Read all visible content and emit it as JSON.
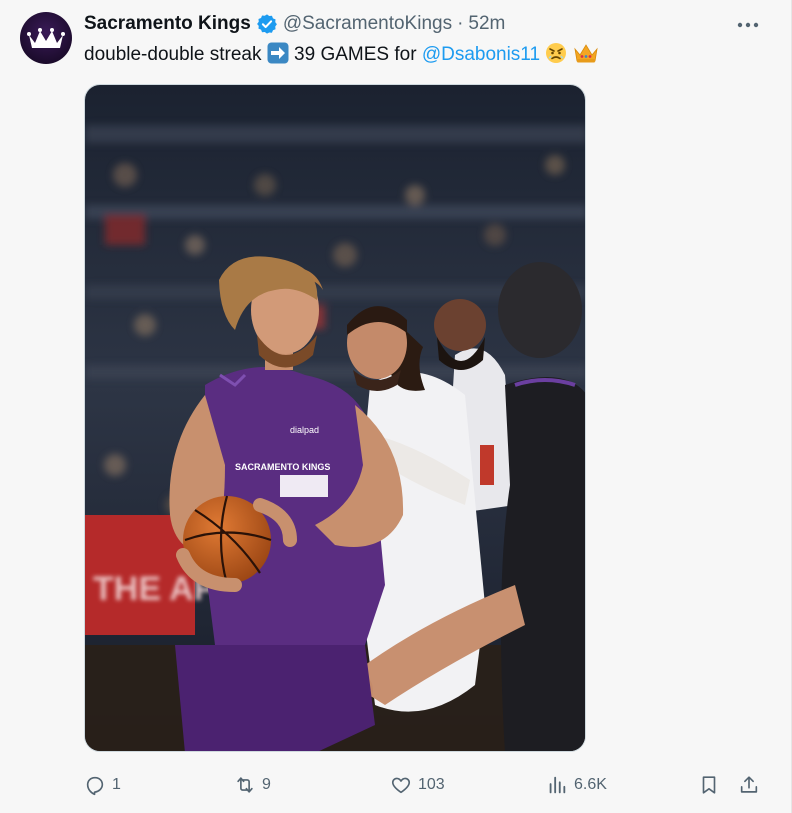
{
  "post": {
    "author_name": "Sacramento Kings",
    "handle": "@SacramentoKings",
    "separator": "·",
    "time": "52m",
    "text_before": "double-double streak",
    "text_middle": "39 GAMES for",
    "mention": "@Dsabonis11",
    "image_alt": "Domantas Sabonis driving with the basketball against the Clippers",
    "jersey_text": "SACRAMENTO KINGS",
    "sponsor_text": "dialpad"
  },
  "actions": {
    "replies": "1",
    "reposts": "9",
    "likes": "103",
    "views": "6.6K"
  },
  "colors": {
    "mention": "#1d9bf0",
    "verified": "#1d9bf0",
    "kings_purple": "#5a2d81",
    "muted": "#536471"
  },
  "icons": [
    "kings-crown-logo",
    "verified-badge-icon",
    "more-icon",
    "right-arrow-emoji",
    "angry-face-emoji",
    "crown-emoji",
    "reply-icon",
    "repost-icon",
    "like-icon",
    "views-icon",
    "bookmark-icon",
    "share-icon"
  ]
}
